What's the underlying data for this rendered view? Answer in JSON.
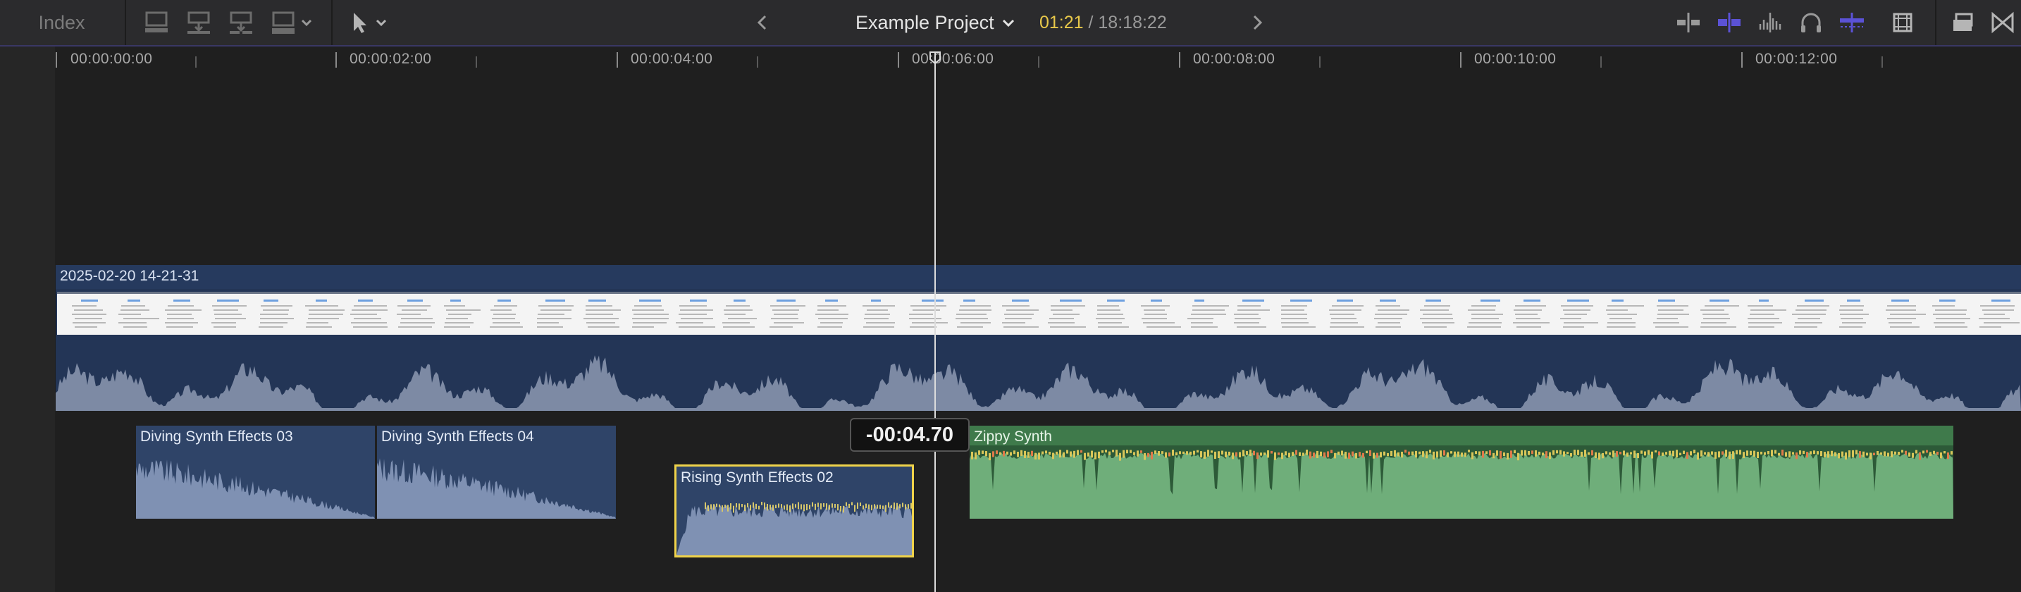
{
  "toolbar": {
    "index_label": "Index",
    "project_name": "Example Project",
    "timecode_current": "01:21",
    "timecode_separator": " / ",
    "timecode_total": "18:18:22",
    "icons": [
      "append-to-storyline-icon",
      "insert-clip-icon",
      "connect-clip-icon",
      "overwrite-clip-icon",
      "select-tool-icon",
      "history-back-icon",
      "history-forward-icon",
      "skimming-icon",
      "snapping-icon",
      "audio-skimming-icon",
      "solo-icon",
      "clip-appearance-icon",
      "effects-browser-icon",
      "timeline-index-icon",
      "transitions-icon"
    ],
    "accent_color": "#5b52d6"
  },
  "ruler": {
    "labels": [
      "00:00:00:00",
      "00:00:02:00",
      "00:00:04:00",
      "00:00:06:00",
      "00:00:08:00",
      "00:00:10:00",
      "00:00:12:00"
    ]
  },
  "primary_clip": {
    "name": "2025-02-20 14-21-31",
    "color": "#263a5e"
  },
  "connected_clips": [
    {
      "name": "Diving Synth Effects 03",
      "color": "#2f4468"
    },
    {
      "name": "Diving Synth Effects 04",
      "color": "#2f4468"
    },
    {
      "name": "Rising Synth Effects 02",
      "color": "#2f4468",
      "selected": true
    },
    {
      "name": "Zippy Synth",
      "color": "#3f7a4b"
    }
  ],
  "playhead": {
    "offset_readout": "-00:04.70"
  }
}
